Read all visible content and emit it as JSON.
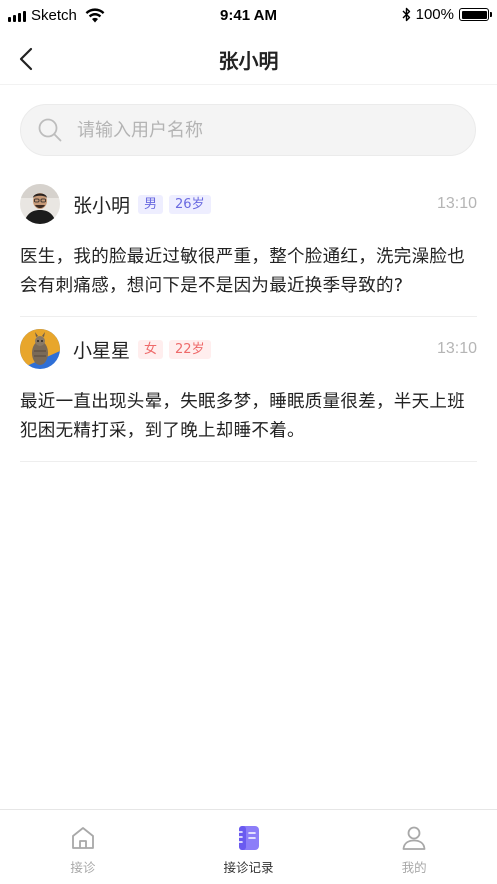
{
  "status_bar": {
    "carrier": "Sketch",
    "time": "9:41 AM",
    "battery": "100%",
    "battery_level": 1.0
  },
  "nav": {
    "title": "张小明",
    "back_icon": "chevron-left-icon"
  },
  "search": {
    "placeholder": "请输入用户名称",
    "icon": "search-icon"
  },
  "messages": [
    {
      "name": "张小明",
      "gender": "男",
      "age": "26岁",
      "time": "13:10",
      "text": "医生，我的脸最近过敏很严重，整个脸通红，洗完澡脸也会有刺痛感，想问下是不是因为最近换季导致的?"
    },
    {
      "name": "小星星",
      "gender": "女",
      "age": "22岁",
      "time": "13:10",
      "text": "最近一直出现头晕，失眠多梦，睡眠质量很差，半天上班犯困无精打采，到了晚上却睡不着。"
    }
  ],
  "tabs": [
    {
      "label": "接诊",
      "icon": "home-icon",
      "active": false
    },
    {
      "label": "接诊记录",
      "icon": "notebook-icon",
      "active": true
    },
    {
      "label": "我的",
      "icon": "user-icon",
      "active": false
    }
  ],
  "colors": {
    "accent": "#7b6ef6",
    "male_tag_bg": "#eeeeff",
    "male_tag_text": "#6a6ae0",
    "female_tag_bg": "#ffeeee",
    "female_tag_text": "#ee6a6a",
    "time_text": "#b5b5b5"
  }
}
